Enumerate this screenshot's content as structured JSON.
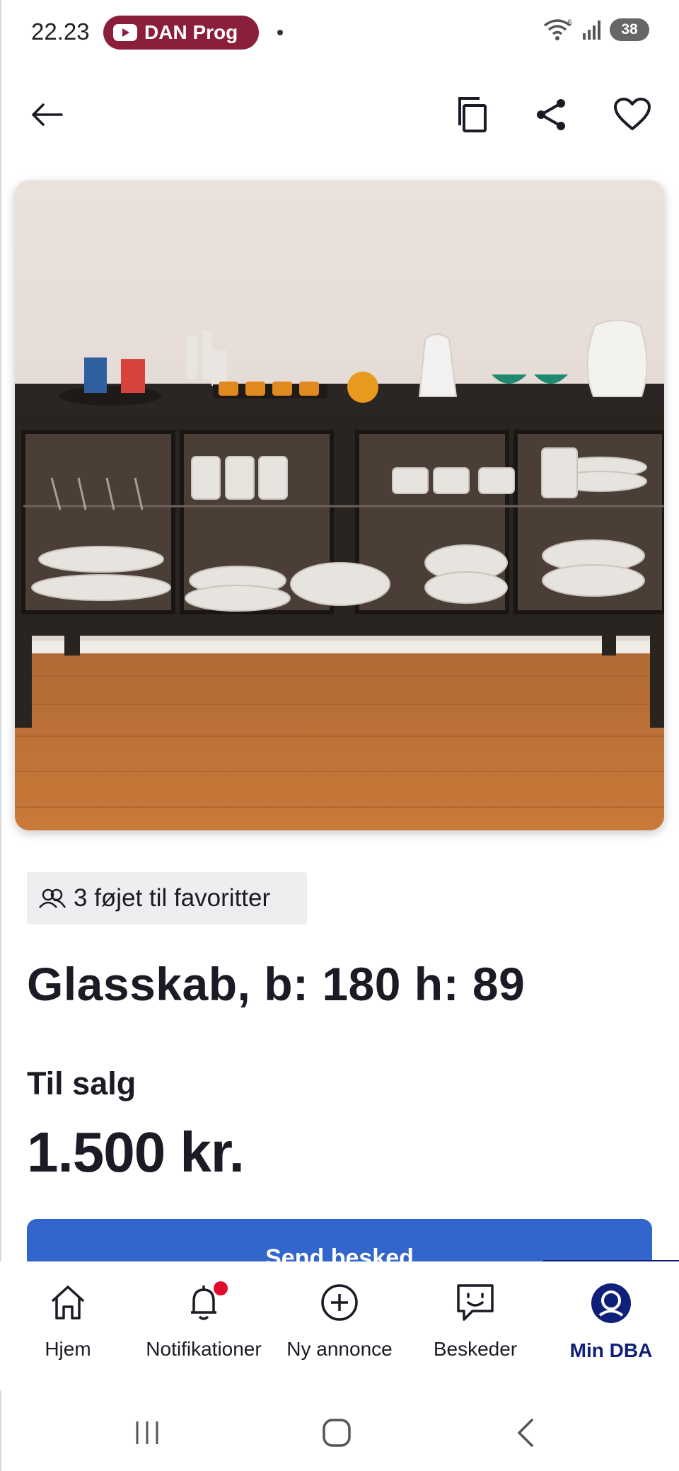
{
  "status_bar": {
    "time": "22.23",
    "notification_pill": "DAN Prog",
    "battery": "38",
    "wifi_label": "6"
  },
  "toolbar": {
    "back_icon": "arrow-left-icon",
    "copy_icon": "copy-icon",
    "share_icon": "share-icon",
    "favorite_icon": "heart-icon"
  },
  "listing": {
    "favorites_text": "3 føjet til favoritter",
    "title": "Glasskab, b: 180 h: 89",
    "sale_label": "Til salg",
    "price": "1.500 kr.",
    "cta_label": "Send besked"
  },
  "bottom_nav": {
    "items": [
      {
        "label": "Hjem",
        "icon": "home-icon"
      },
      {
        "label": "Notifikationer",
        "icon": "bell-icon"
      },
      {
        "label": "Ny annonce",
        "icon": "plus-circle-icon"
      },
      {
        "label": "Beskeder",
        "icon": "chat-icon"
      },
      {
        "label": "Min DBA",
        "icon": "profile-icon"
      }
    ]
  },
  "colors": {
    "accent": "#3366cc",
    "active_nav": "#0f1f7a",
    "notification_dot": "#e00c2c",
    "pill": "#8b1f3b"
  }
}
